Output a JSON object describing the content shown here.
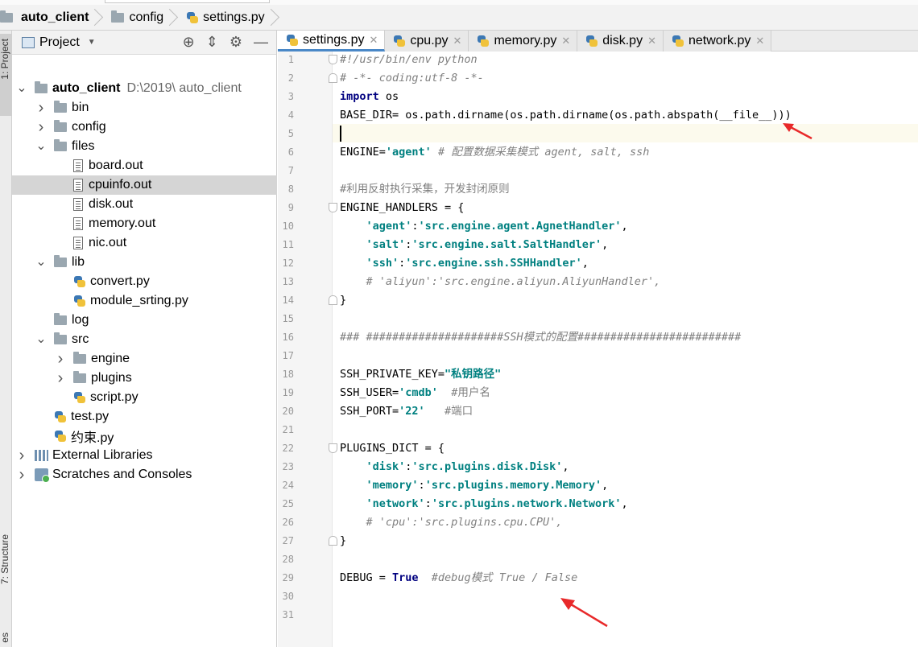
{
  "breadcrumb": {
    "project": "auto_client",
    "folder": "config",
    "file": "settings.py"
  },
  "toolstrip": {
    "project_label": "1: Project",
    "structure_label": "7: Structure",
    "bottom_label": "es"
  },
  "project_panel": {
    "title": "Project",
    "tree": [
      {
        "label": "auto_client",
        "path": "D:\\2019\\ auto_client",
        "indent": 0,
        "icon": "folder",
        "arrow": "down",
        "bold": true
      },
      {
        "label": "bin",
        "indent": 1,
        "icon": "folder",
        "arrow": "right"
      },
      {
        "label": "config",
        "indent": 1,
        "icon": "folder",
        "arrow": "right"
      },
      {
        "label": "files",
        "indent": 1,
        "icon": "folder",
        "arrow": "down"
      },
      {
        "label": "board.out",
        "indent": 2,
        "icon": "file",
        "arrow": ""
      },
      {
        "label": "cpuinfo.out",
        "indent": 2,
        "icon": "file",
        "arrow": "",
        "selected": true
      },
      {
        "label": "disk.out",
        "indent": 2,
        "icon": "file",
        "arrow": ""
      },
      {
        "label": "memory.out",
        "indent": 2,
        "icon": "file",
        "arrow": ""
      },
      {
        "label": "nic.out",
        "indent": 2,
        "icon": "file",
        "arrow": ""
      },
      {
        "label": "lib",
        "indent": 1,
        "icon": "folder",
        "arrow": "down"
      },
      {
        "label": "convert.py",
        "indent": 2,
        "icon": "py",
        "arrow": ""
      },
      {
        "label": "module_srting.py",
        "indent": 2,
        "icon": "py",
        "arrow": ""
      },
      {
        "label": "log",
        "indent": 1,
        "icon": "folder",
        "arrow": ""
      },
      {
        "label": "src",
        "indent": 1,
        "icon": "folder",
        "arrow": "down"
      },
      {
        "label": "engine",
        "indent": 2,
        "icon": "folder",
        "arrow": "right"
      },
      {
        "label": "plugins",
        "indent": 2,
        "icon": "folder",
        "arrow": "right"
      },
      {
        "label": "script.py",
        "indent": 2,
        "icon": "py",
        "arrow": ""
      },
      {
        "label": "test.py",
        "indent": 1,
        "icon": "py",
        "arrow": ""
      },
      {
        "label": "约束.py",
        "indent": 1,
        "icon": "py",
        "arrow": ""
      },
      {
        "label": "External Libraries",
        "indent": 0,
        "icon": "lib",
        "arrow": "right"
      },
      {
        "label": "Scratches and Consoles",
        "indent": 0,
        "icon": "scratch",
        "arrow": "right"
      }
    ]
  },
  "editor_tabs": [
    {
      "label": "settings.py",
      "active": true
    },
    {
      "label": "cpu.py",
      "active": false
    },
    {
      "label": "memory.py",
      "active": false
    },
    {
      "label": "disk.py",
      "active": false
    },
    {
      "label": "network.py",
      "active": false
    }
  ],
  "code_lines": [
    [
      {
        "t": "#!/usr/bin/env python",
        "c": "cmt"
      }
    ],
    [
      {
        "t": "# -*- coding:utf-8 -*-",
        "c": "cmt"
      }
    ],
    [
      {
        "t": "import",
        "c": "kw"
      },
      {
        "t": " os",
        "c": "cn"
      }
    ],
    [
      {
        "t": "BASE_DIR= os.path.dirname(os.path.dirname(os.path.abspath(__file__)))",
        "c": "cn"
      }
    ],
    [],
    [
      {
        "t": "ENGINE=",
        "c": "cn"
      },
      {
        "t": "'agent'",
        "c": "str"
      },
      {
        "t": " # 配置数据采集模式 agent, salt, ssh",
        "c": "cmt"
      }
    ],
    [],
    [
      {
        "t": "#利用反射执行采集，开发封闭原则",
        "c": "cmt-plain"
      }
    ],
    [
      {
        "t": "ENGINE_HANDLERS = {",
        "c": "cn"
      }
    ],
    [
      {
        "t": "    'agent'",
        "c": "str"
      },
      {
        "t": ":",
        "c": "cn"
      },
      {
        "t": "'src.engine.agent.AgnetHandler'",
        "c": "str"
      },
      {
        "t": ",",
        "c": "cn"
      }
    ],
    [
      {
        "t": "    'salt'",
        "c": "str"
      },
      {
        "t": ":",
        "c": "cn"
      },
      {
        "t": "'src.engine.salt.SaltHandler'",
        "c": "str"
      },
      {
        "t": ",",
        "c": "cn"
      }
    ],
    [
      {
        "t": "    'ssh'",
        "c": "str"
      },
      {
        "t": ":",
        "c": "cn"
      },
      {
        "t": "'src.engine.ssh.SSHHandler'",
        "c": "str"
      },
      {
        "t": ",",
        "c": "cn"
      }
    ],
    [
      {
        "t": "    # 'aliyun':'src.engine.aliyun.AliyunHandler',",
        "c": "cmt"
      }
    ],
    [
      {
        "t": "}",
        "c": "cn"
      }
    ],
    [],
    [
      {
        "t": "### #####################SSH模式的配置#########################",
        "c": "cmt"
      }
    ],
    [],
    [
      {
        "t": "SSH_PRIVATE_KEY=",
        "c": "cn"
      },
      {
        "t": "\"私钥路径\"",
        "c": "str"
      }
    ],
    [
      {
        "t": "SSH_USER=",
        "c": "cn"
      },
      {
        "t": "'cmdb'",
        "c": "str"
      },
      {
        "t": "  #用户名",
        "c": "cmt-plain"
      }
    ],
    [
      {
        "t": "SSH_PORT=",
        "c": "cn"
      },
      {
        "t": "'22'",
        "c": "str"
      },
      {
        "t": "   #端口",
        "c": "cmt-plain"
      }
    ],
    [],
    [
      {
        "t": "PLUGINS_DICT = {",
        "c": "cn"
      }
    ],
    [
      {
        "t": "    'disk'",
        "c": "str"
      },
      {
        "t": ":",
        "c": "cn"
      },
      {
        "t": "'src.plugins.disk.Disk'",
        "c": "str"
      },
      {
        "t": ",",
        "c": "cn"
      }
    ],
    [
      {
        "t": "    'memory'",
        "c": "str"
      },
      {
        "t": ":",
        "c": "cn"
      },
      {
        "t": "'src.plugins.memory.Memory'",
        "c": "str"
      },
      {
        "t": ",",
        "c": "cn"
      }
    ],
    [
      {
        "t": "    'network'",
        "c": "str"
      },
      {
        "t": ":",
        "c": "cn"
      },
      {
        "t": "'src.plugins.network.Network'",
        "c": "str"
      },
      {
        "t": ",",
        "c": "cn"
      }
    ],
    [
      {
        "t": "    # 'cpu':'src.plugins.cpu.CPU',",
        "c": "cmt"
      }
    ],
    [
      {
        "t": "}",
        "c": "cn"
      }
    ],
    [],
    [
      {
        "t": "DEBUG = ",
        "c": "cn"
      },
      {
        "t": "True",
        "c": "boldc"
      },
      {
        "t": "  #debug模式 True / False",
        "c": "cmt"
      }
    ],
    [],
    []
  ],
  "colors": {
    "accent": "#4a88c7",
    "keyword": "#000080",
    "string": "#008080",
    "comment": "#808080",
    "annotation_arrow": "#e8292a"
  }
}
